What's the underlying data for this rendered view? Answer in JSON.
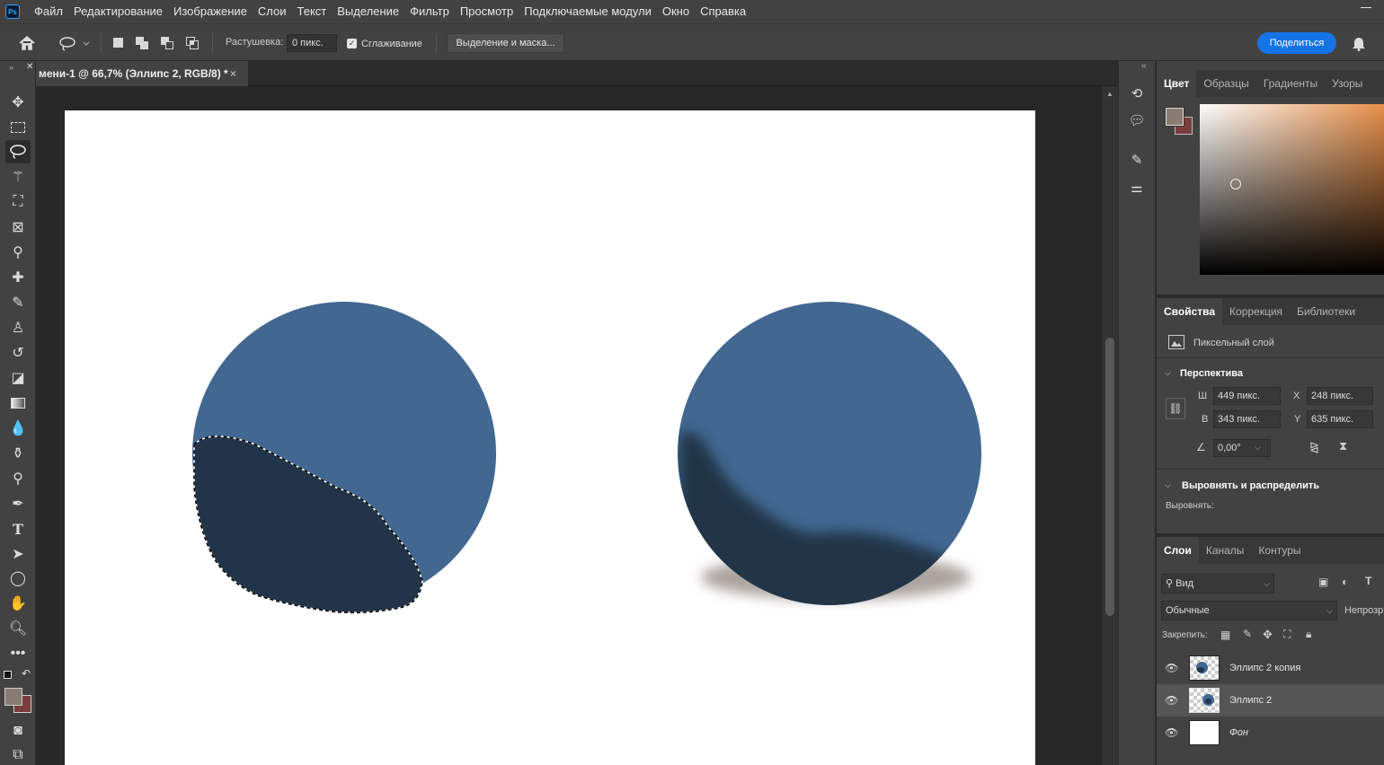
{
  "app": {
    "logo": "Ps"
  },
  "menu": [
    "Файл",
    "Редактирование",
    "Изображение",
    "Слои",
    "Текст",
    "Выделение",
    "Фильтр",
    "Просмотр",
    "Подключаемые модули",
    "Окно",
    "Справка"
  ],
  "options": {
    "feather_label": "Растушевка:",
    "feather_value": "0 пикс.",
    "antialias_label": "Сглаживание",
    "antialias_checked": true,
    "select_mask_button": "Выделение и маска...",
    "share_button": "Поделиться"
  },
  "document": {
    "tab_title": "мени-1 @ 66,7% (Эллипс 2, RGB/8) *",
    "tab_close": "×",
    "circle_color": "#426891",
    "shadow_color": "#223447"
  },
  "color_panel": {
    "tabs": [
      "Цвет",
      "Образцы",
      "Градиенты",
      "Узоры"
    ],
    "foreground": "#8a7b73",
    "background": "#7a3d3b",
    "picker_hue": "#e6904a"
  },
  "properties_panel": {
    "tabs": [
      "Свойства",
      "Коррекция",
      "Библиотеки"
    ],
    "layer_type": "Пиксельный слой",
    "section_transform": "Перспектива",
    "w_label": "Ш",
    "w_value": "449 пикс.",
    "h_label": "В",
    "h_value": "343 пикс.",
    "x_label": "X",
    "x_value": "248 пикс.",
    "y_label": "Y",
    "y_value": "635 пикс.",
    "angle_value": "0,00°",
    "section_align": "Выровнять и распределить",
    "align_label": "Выровнять:"
  },
  "layers_panel": {
    "tabs": [
      "Слои",
      "Каналы",
      "Контуры"
    ],
    "filter_placeholder": "Вид",
    "blend_mode": "Обычные",
    "opacity_label": "Непрозр",
    "lock_label": "Закрепить:",
    "layers": [
      {
        "name": "Эллипс 2 копия",
        "selected": false
      },
      {
        "name": "Эллипс 2",
        "selected": true
      },
      {
        "name": "Фон",
        "selected": false
      }
    ]
  }
}
